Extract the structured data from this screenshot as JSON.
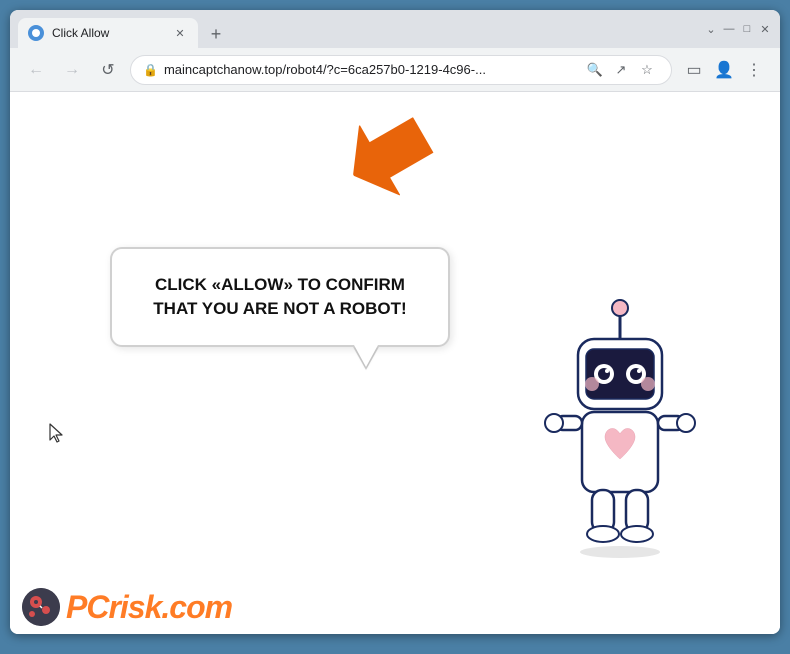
{
  "browser": {
    "title": "Click Allow",
    "url": "maincaptchanow.top/robot4/?c=6ca257b0-1219-4c96-...",
    "tab_label": "Click Allow",
    "new_tab_icon": "+",
    "nav": {
      "back": "←",
      "forward": "→",
      "reload": "↺"
    },
    "window_controls": {
      "minimize": "—",
      "maximize": "□",
      "close": "✕"
    },
    "toolbar": {
      "search": "🔍",
      "share": "↗",
      "bookmark": "☆",
      "sidebar": "▭",
      "profile": "👤",
      "menu": "⋮"
    }
  },
  "page": {
    "bubble_text": "CLICK «ALLOW» TO CONFIRM THAT YOU ARE NOT A ROBOT!",
    "watermark_text": "PC",
    "watermark_suffix": "risk.com"
  },
  "colors": {
    "orange_arrow": "#e8640a",
    "bubble_border": "#d0d0d0",
    "accent": "#ff6600",
    "browser_bg": "#dee1e6"
  }
}
